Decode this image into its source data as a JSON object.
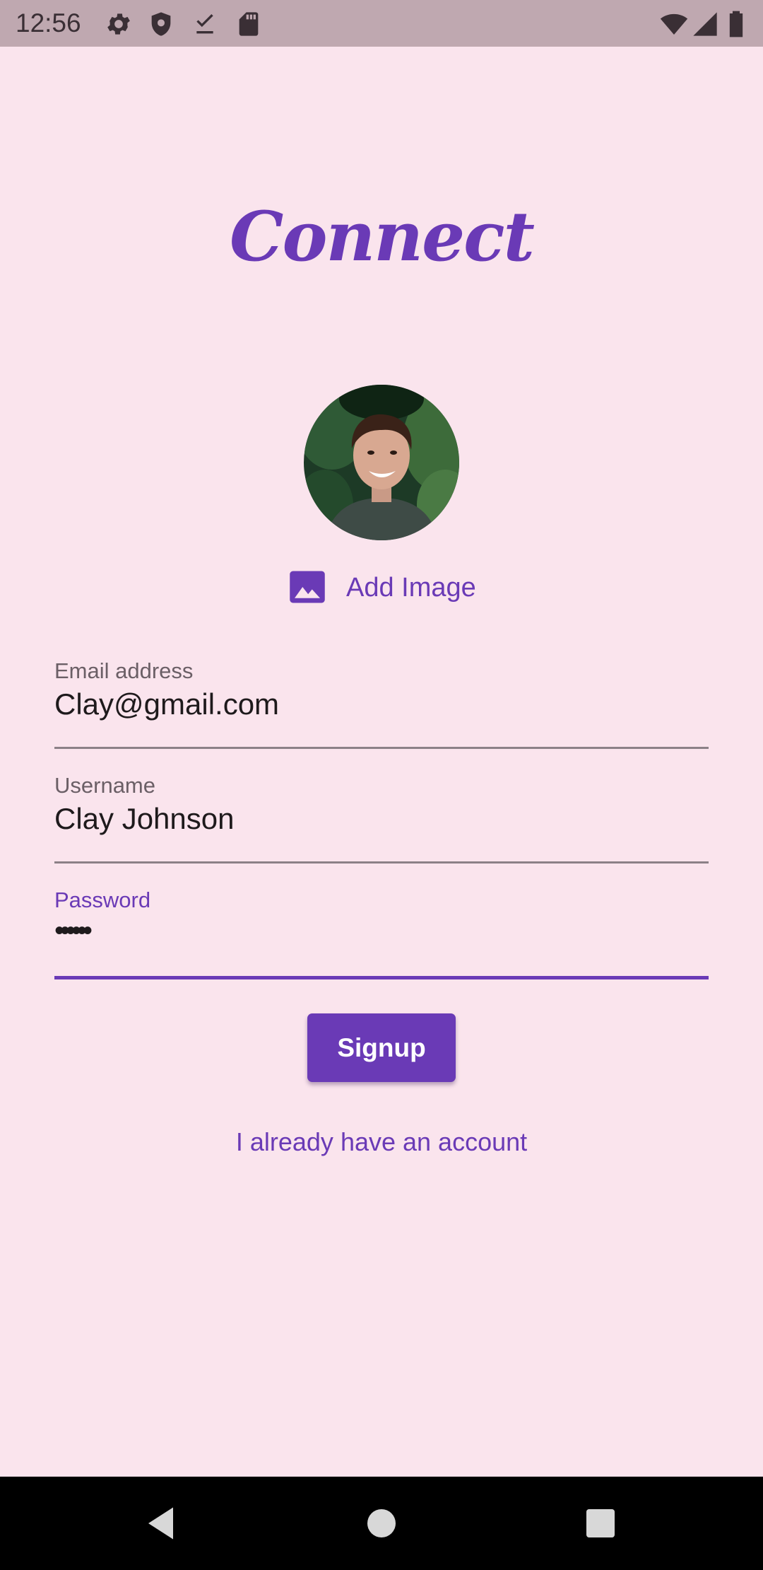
{
  "status_bar": {
    "time": "12:56",
    "left_icons": [
      "settings-icon",
      "shield-icon",
      "download-done-icon",
      "sd-card-icon"
    ],
    "right_icons": [
      "wifi-icon",
      "signal-icon",
      "battery-icon"
    ]
  },
  "app": {
    "title": "Connect",
    "accent_color": "#6a3ab6",
    "background_color": "#fae4ed"
  },
  "profile": {
    "avatar": "profile-photo",
    "add_image_label": "Add Image",
    "add_image_icon": "image-icon"
  },
  "form": {
    "email": {
      "label": "Email address",
      "value": "Clay@gmail.com"
    },
    "username": {
      "label": "Username",
      "value": "Clay Johnson"
    },
    "password": {
      "label": "Password",
      "value": "••••••",
      "focused": true
    }
  },
  "actions": {
    "signup_label": "Signup",
    "login_link_label": "I already have an account"
  },
  "nav_bar": {
    "buttons": [
      "back-icon",
      "home-icon",
      "recents-icon"
    ]
  }
}
